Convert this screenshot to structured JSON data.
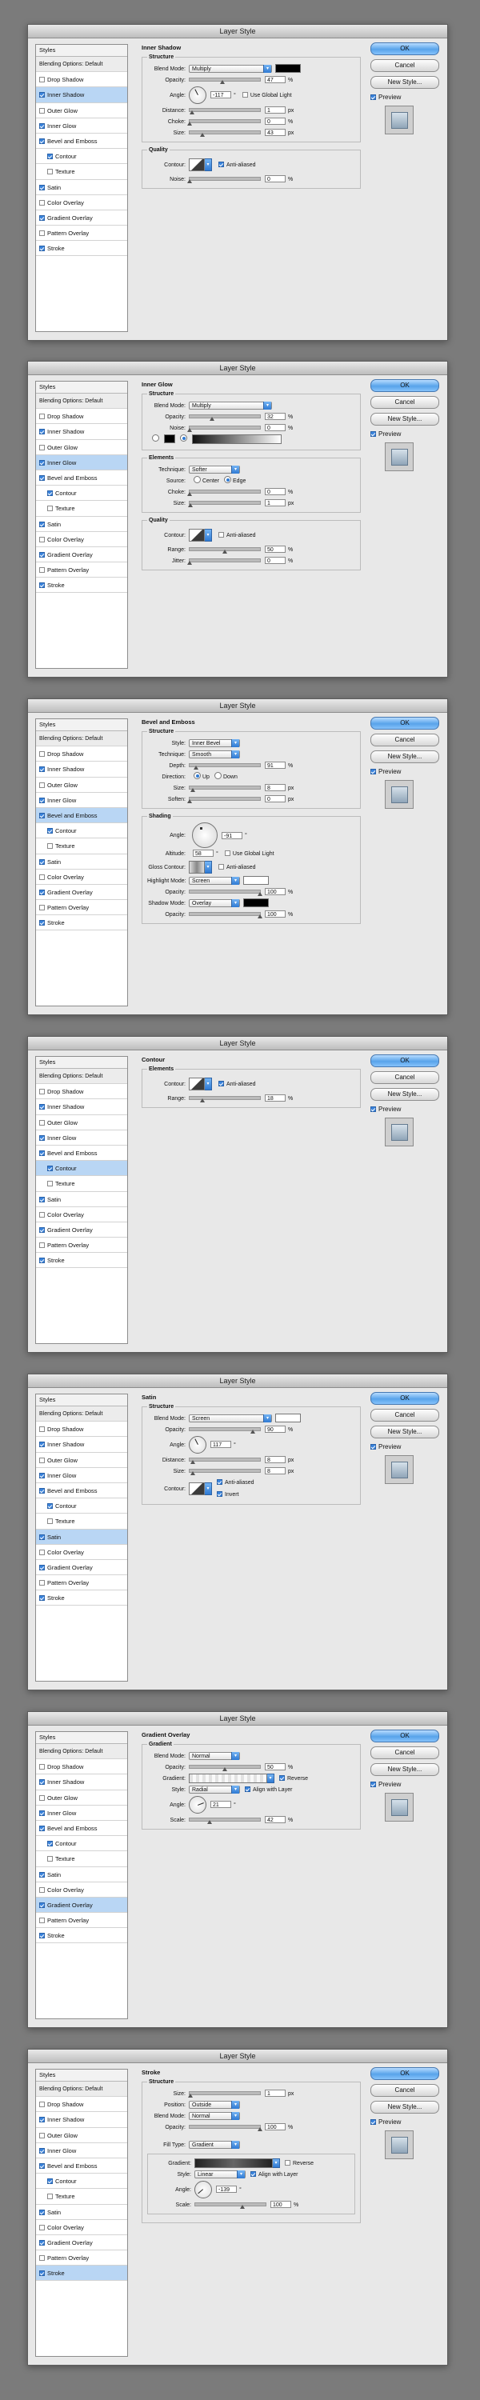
{
  "dialog_title": "Layer Style",
  "buttons": {
    "ok": "OK",
    "cancel": "Cancel",
    "new_style": "New Style...",
    "preview": "Preview"
  },
  "styles_header": "Styles",
  "blending_options": "Blending Options: Default",
  "style_items": [
    "Drop Shadow",
    "Inner Shadow",
    "Outer Glow",
    "Inner Glow",
    "Bevel and Emboss",
    "Contour",
    "Texture",
    "Satin",
    "Color Overlay",
    "Gradient Overlay",
    "Pattern Overlay",
    "Stroke"
  ],
  "colors": {
    "accent": "#3a84dd",
    "selected_row": "#b9d6f4",
    "black_swatch": "#000000"
  },
  "dialogs": [
    {
      "title": "Inner Shadow",
      "checked": [
        false,
        true,
        false,
        true,
        true,
        true,
        false,
        true,
        false,
        true,
        false,
        true
      ],
      "selected": 1,
      "structure_legend": "Structure",
      "blend_mode_label": "Blend Mode:",
      "blend_mode": "Multiply",
      "opacity_label": "Opacity:",
      "opacity": "47",
      "angle_label": "Angle:",
      "angle": "-117",
      "global_light": "Use Global Light",
      "distance_label": "Distance:",
      "distance": "1",
      "choke_label": "Choke:",
      "choke": "0",
      "size_label": "Size:",
      "size": "43",
      "quality_legend": "Quality",
      "contour_label": "Contour:",
      "anti_aliased": "Anti-aliased",
      "noise_label": "Noise:",
      "noise": "0",
      "pct": "%",
      "px": "px",
      "deg": "°"
    },
    {
      "title": "Inner Glow",
      "checked": [
        false,
        true,
        false,
        true,
        true,
        true,
        false,
        true,
        false,
        true,
        false,
        true
      ],
      "selected": 3,
      "structure_legend": "Structure",
      "blend_mode_label": "Blend Mode:",
      "blend_mode": "Multiply",
      "opacity_label": "Opacity:",
      "opacity": "32",
      "noise_label": "Noise:",
      "noise": "0",
      "elements_legend": "Elements",
      "technique_label": "Technique:",
      "technique": "Softer",
      "source_label": "Source:",
      "center": "Center",
      "edge": "Edge",
      "choke_label": "Choke:",
      "choke": "0",
      "size_label": "Size:",
      "size": "1",
      "quality_legend": "Quality",
      "contour_label": "Contour:",
      "anti_aliased": "Anti-aliased",
      "range_label": "Range:",
      "range": "50",
      "jitter_label": "Jitter:",
      "jitter": "0",
      "pct": "%",
      "px": "px"
    },
    {
      "title": "Bevel and Emboss",
      "checked": [
        false,
        true,
        false,
        true,
        true,
        true,
        false,
        true,
        false,
        true,
        false,
        true
      ],
      "selected": 4,
      "structure_legend": "Structure",
      "style_label": "Style:",
      "style": "Inner Bevel",
      "technique_label": "Technique:",
      "technique": "Smooth",
      "depth_label": "Depth:",
      "depth": "91",
      "direction_label": "Direction:",
      "up": "Up",
      "down": "Down",
      "size_label": "Size:",
      "size": "8",
      "soften_label": "Soften:",
      "soften": "0",
      "shading_legend": "Shading",
      "angle_label": "Angle:",
      "angle": "-91",
      "global_light": "Use Global Light",
      "altitude_label": "Altitude:",
      "altitude": "58",
      "gloss_label": "Gloss Contour:",
      "anti_aliased": "Anti-aliased",
      "highlight_label": "Highlight Mode:",
      "highlight": "Screen",
      "hl_opacity_label": "Opacity:",
      "hl_opacity": "100",
      "shadow_label": "Shadow Mode:",
      "shadow": "Overlay",
      "sh_opacity_label": "Opacity:",
      "sh_opacity": "100",
      "pct": "%",
      "px": "px",
      "deg": "°"
    },
    {
      "title": "Contour",
      "checked": [
        false,
        true,
        false,
        true,
        true,
        true,
        false,
        true,
        false,
        true,
        false,
        true
      ],
      "selected": 5,
      "elements_legend": "Elements",
      "contour_label": "Contour:",
      "anti_aliased": "Anti-aliased",
      "range_label": "Range:",
      "range": "18",
      "pct": "%"
    },
    {
      "title": "Satin",
      "checked": [
        false,
        true,
        false,
        true,
        true,
        true,
        false,
        true,
        false,
        true,
        false,
        true
      ],
      "selected": 7,
      "structure_legend": "Structure",
      "blend_mode_label": "Blend Mode:",
      "blend_mode": "Screen",
      "opacity_label": "Opacity:",
      "opacity": "90",
      "angle_label": "Angle:",
      "angle": "117",
      "distance_label": "Distance:",
      "distance": "8",
      "size_label": "Size:",
      "size": "8",
      "contour_label": "Contour:",
      "anti_aliased": "Anti-aliased",
      "invert": "Invert",
      "pct": "%",
      "px": "px",
      "deg": "°"
    },
    {
      "title": "Gradient Overlay",
      "checked": [
        false,
        true,
        false,
        true,
        true,
        true,
        false,
        true,
        false,
        true,
        false,
        true
      ],
      "selected": 9,
      "gradient_legend": "Gradient",
      "blend_mode_label": "Blend Mode:",
      "blend_mode": "Normal",
      "opacity_label": "Opacity:",
      "opacity": "50",
      "gradient_label": "Gradient:",
      "reverse": "Reverse",
      "style_label": "Style:",
      "style": "Radial",
      "align": "Align with Layer",
      "angle_label": "Angle:",
      "angle": "21",
      "scale_label": "Scale:",
      "scale": "42",
      "pct": "%",
      "deg": "°"
    },
    {
      "title": "Stroke",
      "checked": [
        false,
        true,
        false,
        true,
        true,
        true,
        false,
        true,
        false,
        true,
        false,
        true
      ],
      "selected": 11,
      "structure_legend": "Structure",
      "size_label": "Size:",
      "size": "1",
      "position_label": "Position:",
      "position": "Outside",
      "blend_mode_label": "Blend Mode:",
      "blend_mode": "Normal",
      "opacity_label": "Opacity:",
      "opacity": "100",
      "fill_type_label": "Fill Type:",
      "fill_type": "Gradient",
      "gradient_label": "Gradient:",
      "reverse": "Reverse",
      "style_label": "Style:",
      "style": "Linear",
      "align": "Align with Layer",
      "angle_label": "Angle:",
      "angle": "-139",
      "scale_label": "Scale:",
      "scale": "100",
      "pct": "%",
      "px": "px",
      "deg": "°"
    }
  ]
}
